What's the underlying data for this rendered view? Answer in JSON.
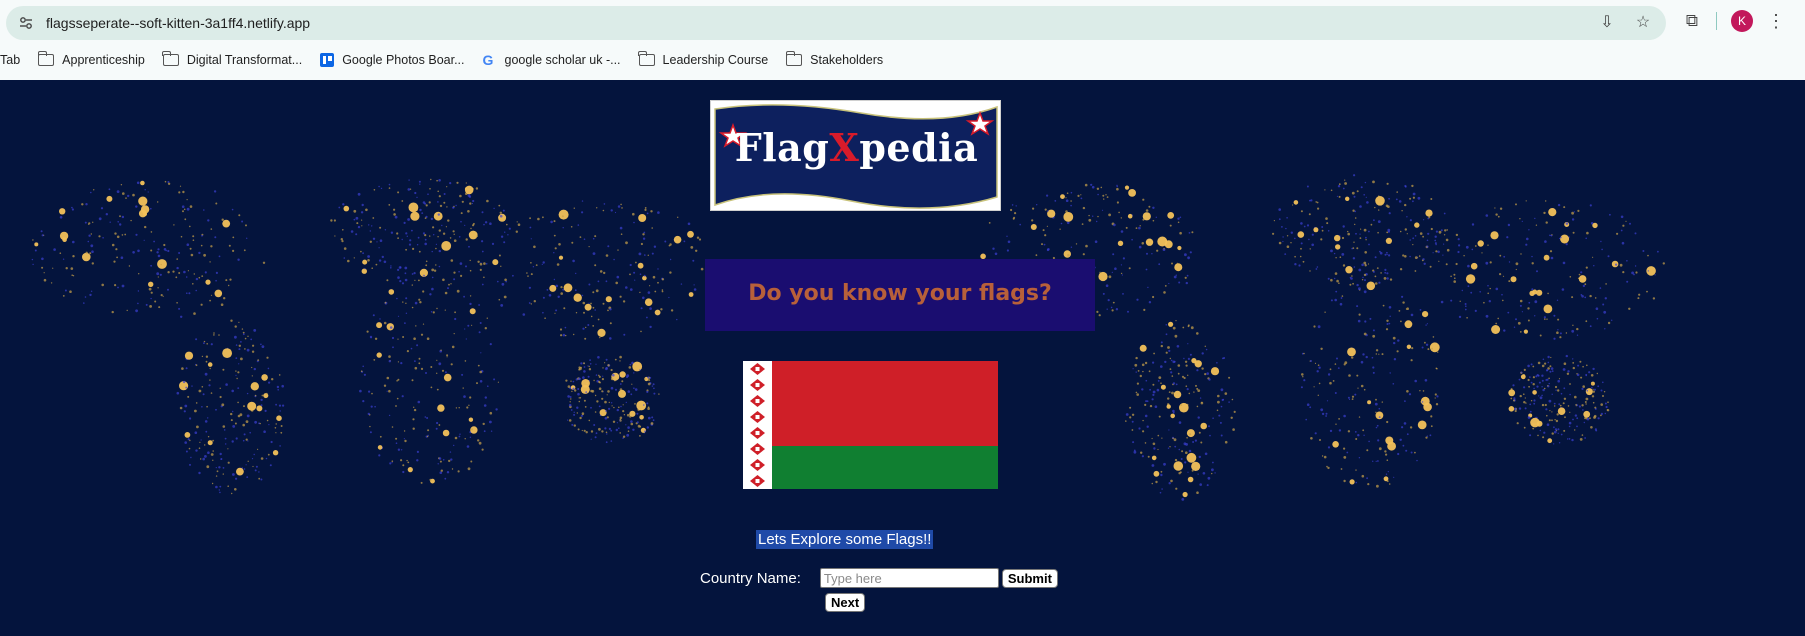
{
  "browser": {
    "url": "flagsseperate--soft-kitten-3a1ff4.netlify.app",
    "profile_initial": "K",
    "bookmarks": [
      {
        "label": "Tab",
        "icon": "none"
      },
      {
        "label": "Apprenticeship",
        "icon": "folder-icon"
      },
      {
        "label": "Digital Transformat...",
        "icon": "folder-icon"
      },
      {
        "label": "Google Photos Boar...",
        "icon": "trello-icon"
      },
      {
        "label": "google scholar uk -...",
        "icon": "google-icon"
      },
      {
        "label": "Leadership Course",
        "icon": "folder-icon"
      },
      {
        "label": "Stakeholders",
        "icon": "folder-icon"
      }
    ]
  },
  "page": {
    "logo": {
      "prefix": "Flag",
      "highlight": "X",
      "suffix": "pedia"
    },
    "quiz_title": "Do you know your flags?",
    "flag_country_shown": "Belarus",
    "explore_text": "Lets Explore some Flags!!",
    "form": {
      "label": "Country Name:",
      "input_value": "",
      "input_placeholder": "Type here",
      "submit_label": "Submit",
      "next_label": "Next"
    }
  },
  "colors": {
    "page_background": "#04143d",
    "banner_background": "#1a0d70",
    "banner_text": "#b8603a",
    "flag_red": "#cf1f28",
    "flag_green": "#107f31",
    "logo_navy": "#0d205e",
    "logo_accent": "#d81b2a"
  }
}
